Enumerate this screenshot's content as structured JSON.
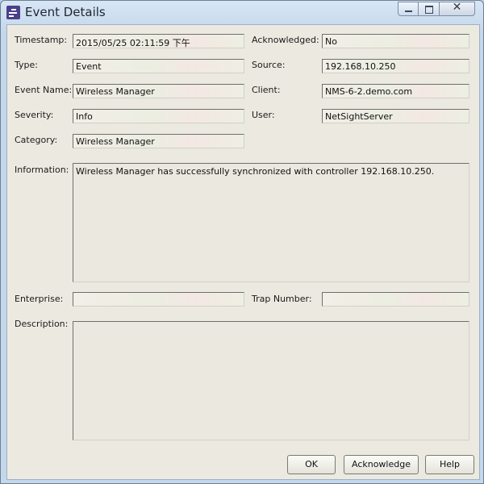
{
  "window": {
    "title": "Event Details",
    "icon": "event-details-app-icon",
    "controls": {
      "minimize": "minimize-icon",
      "maximize": "maximize-icon",
      "close": "✕"
    }
  },
  "labels": {
    "timestamp": "Timestamp:",
    "type": "Type:",
    "event_name": "Event Name:",
    "severity": "Severity:",
    "category": "Category:",
    "acknowledged": "Acknowledged:",
    "source": "Source:",
    "client": "Client:",
    "user": "User:",
    "information": "Information:",
    "enterprise": "Enterprise:",
    "trap_number": "Trap Number:",
    "description": "Description:"
  },
  "values": {
    "timestamp": "2015/05/25 02:11:59 下午",
    "type": "Event",
    "event_name": "Wireless Manager",
    "severity": "Info",
    "category": "Wireless Manager",
    "acknowledged": "No",
    "source": "192.168.10.250",
    "client": "NMS-6-2.demo.com",
    "user": "NetSightServer",
    "information": "Wireless Manager has successfully synchronized with controller 192.168.10.250.",
    "enterprise": "",
    "trap_number": "",
    "description": ""
  },
  "buttons": {
    "ok": "OK",
    "acknowledge": "Acknowledge",
    "help": "Help"
  }
}
